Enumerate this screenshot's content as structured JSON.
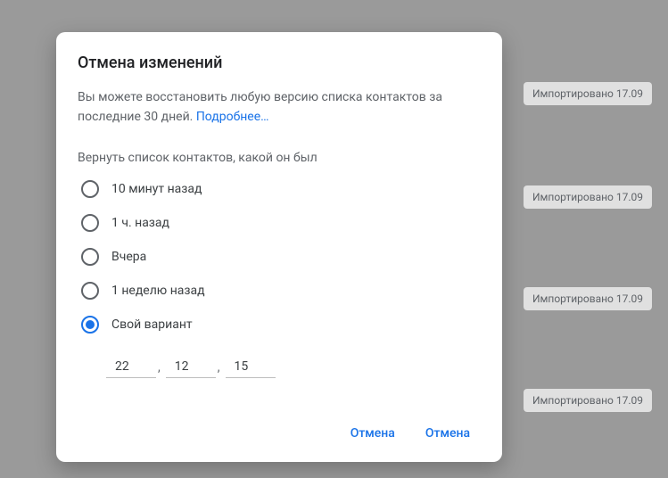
{
  "background": {
    "badges": [
      "Импортировано 17.09",
      "Импортировано 17.09",
      "Импортировано 17.09",
      "Импортировано 17.09"
    ]
  },
  "dialog": {
    "title": "Отмена изменений",
    "description_1": "Вы можете восстановить любую версию списка контактов за последние 30 дней. ",
    "learn_more": "Подробнее…",
    "section_label": "Вернуть список контактов, какой он был",
    "options": [
      {
        "label": "10 минут назад",
        "selected": false
      },
      {
        "label": "1 ч. назад",
        "selected": false
      },
      {
        "label": "Вчера",
        "selected": false
      },
      {
        "label": "1 неделю назад",
        "selected": false
      },
      {
        "label": "Свой вариант",
        "selected": true
      }
    ],
    "custom": {
      "value1": "22",
      "value2": "12",
      "value3": "15",
      "sep": ","
    },
    "actions": {
      "cancel": "Отмена",
      "confirm": "Отмена"
    }
  }
}
